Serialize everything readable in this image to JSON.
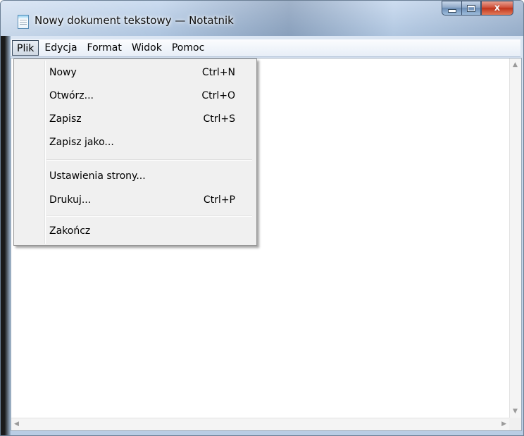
{
  "window": {
    "title": "Nowy dokument tekstowy — Notatnik",
    "caption_close_glyph": "x",
    "accent_color": "#b9cde4"
  },
  "menubar": {
    "items": [
      {
        "label": "Plik",
        "active": true
      },
      {
        "label": "Edycja"
      },
      {
        "label": "Format"
      },
      {
        "label": "Widok"
      },
      {
        "label": "Pomoc"
      }
    ]
  },
  "file_menu": {
    "items": [
      {
        "label": "Nowy",
        "shortcut": "Ctrl+N"
      },
      {
        "label": "Otwórz...",
        "shortcut": "Ctrl+O"
      },
      {
        "label": "Zapisz",
        "shortcut": "Ctrl+S"
      },
      {
        "label": "Zapisz jako...",
        "shortcut": ""
      },
      {
        "label": "Ustawienia strony...",
        "shortcut": ""
      },
      {
        "label": "Drukuj...",
        "shortcut": "Ctrl+P"
      },
      {
        "label": "Zakończ",
        "shortcut": ""
      }
    ]
  },
  "editor": {
    "content": ""
  },
  "scrollbars": {
    "up_arrow": "▲",
    "down_arrow": "▼",
    "left_arrow": "◀",
    "right_arrow": "▶"
  }
}
